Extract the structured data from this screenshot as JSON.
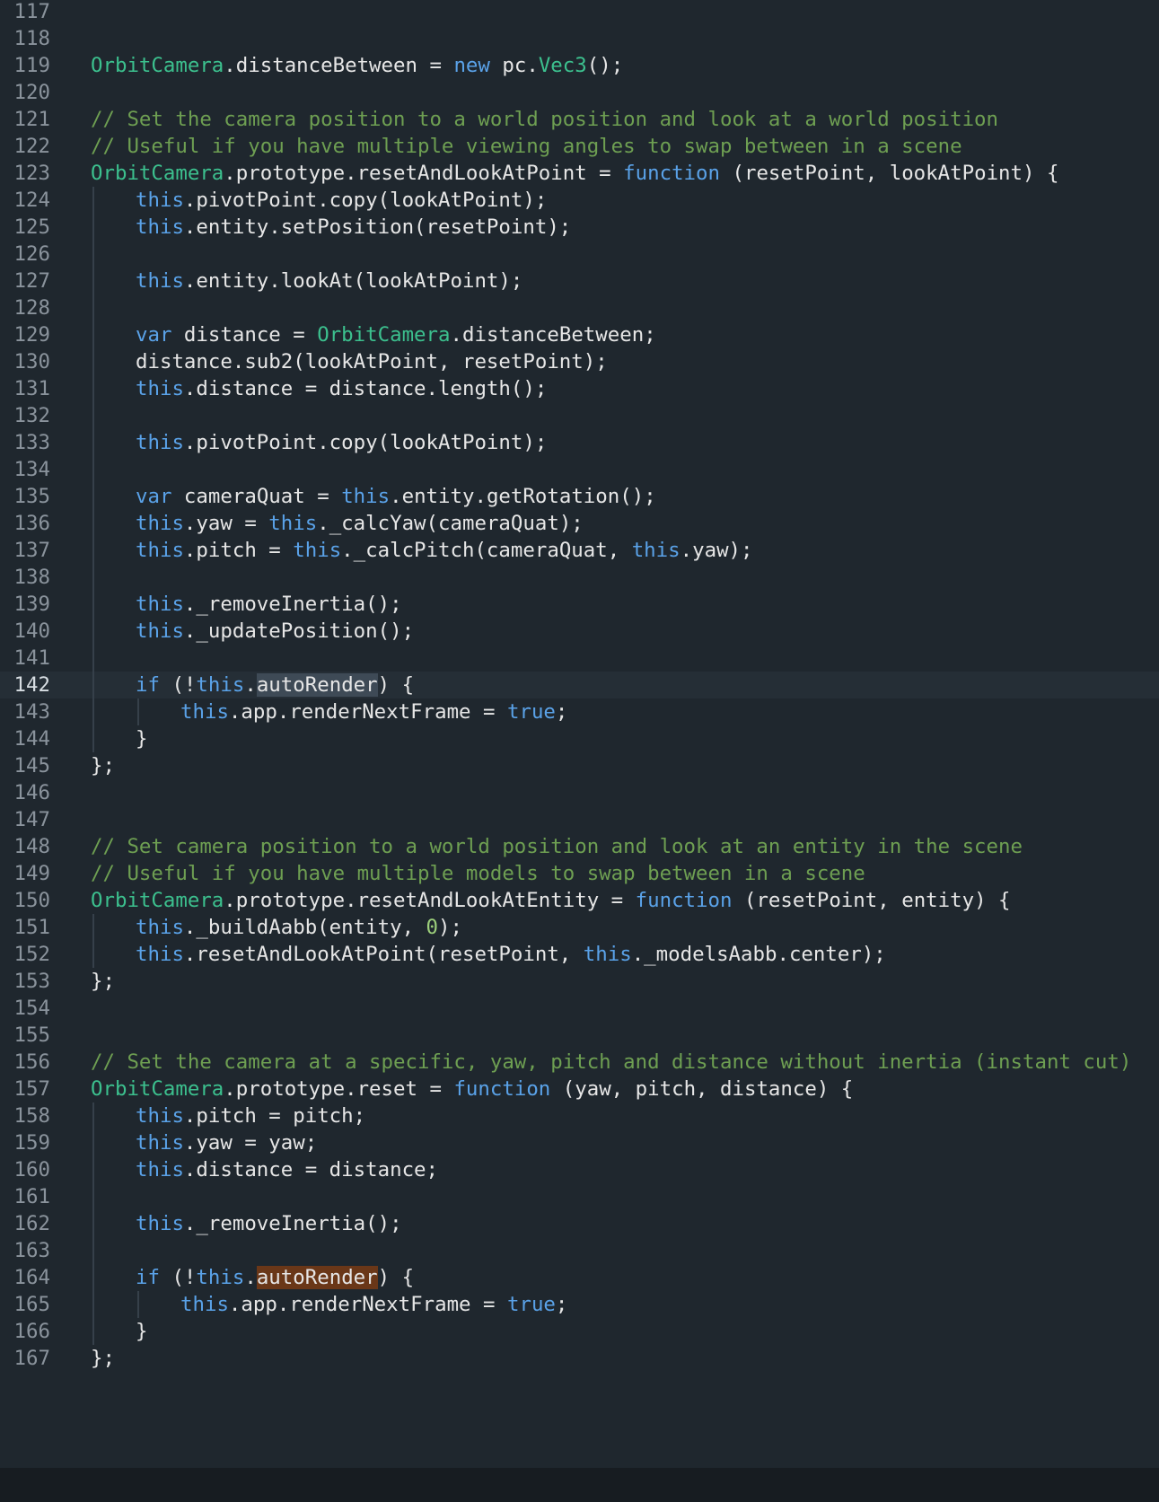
{
  "editor": {
    "language": "javascript",
    "current_line": 142,
    "colors": {
      "background": "#1f272e",
      "keyword": "#5aa2e8",
      "class": "#3cc08e",
      "comment": "#6e9f52",
      "number": "#9ccf7b",
      "selection_highlight": "#3e4a56",
      "find_highlight": "#6a3718"
    },
    "lines": [
      {
        "n": "117",
        "indent": 0,
        "tokens": []
      },
      {
        "n": "118",
        "indent": 0,
        "tokens": []
      },
      {
        "n": "119",
        "indent": 0,
        "tokens": [
          [
            "cls",
            "OrbitCamera"
          ],
          [
            "txt",
            ".distanceBetween = "
          ],
          [
            "kw",
            "new"
          ],
          [
            "txt",
            " pc."
          ],
          [
            "cls",
            "Vec3"
          ],
          [
            "txt",
            "();"
          ]
        ]
      },
      {
        "n": "120",
        "indent": 0,
        "tokens": []
      },
      {
        "n": "121",
        "indent": 0,
        "tokens": [
          [
            "cm",
            "// Set the camera position to a world position and look at a world position"
          ]
        ]
      },
      {
        "n": "122",
        "indent": 0,
        "tokens": [
          [
            "cm",
            "// Useful if you have multiple viewing angles to swap between in a scene"
          ]
        ]
      },
      {
        "n": "123",
        "indent": 0,
        "tokens": [
          [
            "cls",
            "OrbitCamera"
          ],
          [
            "txt",
            ".prototype.resetAndLookAtPoint = "
          ],
          [
            "kw",
            "function"
          ],
          [
            "txt",
            " (resetPoint, lookAtPoint) {"
          ]
        ]
      },
      {
        "n": "124",
        "indent": 1,
        "tokens": [
          [
            "kw",
            "this"
          ],
          [
            "txt",
            ".pivotPoint.copy(lookAtPoint);"
          ]
        ]
      },
      {
        "n": "125",
        "indent": 1,
        "tokens": [
          [
            "kw",
            "this"
          ],
          [
            "txt",
            ".entity.setPosition(resetPoint);"
          ]
        ]
      },
      {
        "n": "126",
        "indent": 1,
        "tokens": []
      },
      {
        "n": "127",
        "indent": 1,
        "tokens": [
          [
            "kw",
            "this"
          ],
          [
            "txt",
            ".entity.lookAt(lookAtPoint);"
          ]
        ]
      },
      {
        "n": "128",
        "indent": 1,
        "tokens": []
      },
      {
        "n": "129",
        "indent": 1,
        "tokens": [
          [
            "kw",
            "var"
          ],
          [
            "txt",
            " distance = "
          ],
          [
            "cls",
            "OrbitCamera"
          ],
          [
            "txt",
            ".distanceBetween;"
          ]
        ]
      },
      {
        "n": "130",
        "indent": 1,
        "tokens": [
          [
            "txt",
            "distance.sub2(lookAtPoint, resetPoint);"
          ]
        ]
      },
      {
        "n": "131",
        "indent": 1,
        "tokens": [
          [
            "kw",
            "this"
          ],
          [
            "txt",
            ".distance = distance.length();"
          ]
        ]
      },
      {
        "n": "132",
        "indent": 1,
        "tokens": []
      },
      {
        "n": "133",
        "indent": 1,
        "tokens": [
          [
            "kw",
            "this"
          ],
          [
            "txt",
            ".pivotPoint.copy(lookAtPoint);"
          ]
        ]
      },
      {
        "n": "134",
        "indent": 1,
        "tokens": []
      },
      {
        "n": "135",
        "indent": 1,
        "tokens": [
          [
            "kw",
            "var"
          ],
          [
            "txt",
            " cameraQuat = "
          ],
          [
            "kw",
            "this"
          ],
          [
            "txt",
            ".entity.getRotation();"
          ]
        ]
      },
      {
        "n": "136",
        "indent": 1,
        "tokens": [
          [
            "kw",
            "this"
          ],
          [
            "txt",
            ".yaw = "
          ],
          [
            "kw",
            "this"
          ],
          [
            "txt",
            "._calcYaw(cameraQuat);"
          ]
        ]
      },
      {
        "n": "137",
        "indent": 1,
        "tokens": [
          [
            "kw",
            "this"
          ],
          [
            "txt",
            ".pitch = "
          ],
          [
            "kw",
            "this"
          ],
          [
            "txt",
            "._calcPitch(cameraQuat, "
          ],
          [
            "kw",
            "this"
          ],
          [
            "txt",
            ".yaw);"
          ]
        ]
      },
      {
        "n": "138",
        "indent": 1,
        "tokens": []
      },
      {
        "n": "139",
        "indent": 1,
        "tokens": [
          [
            "kw",
            "this"
          ],
          [
            "txt",
            "._removeInertia();"
          ]
        ]
      },
      {
        "n": "140",
        "indent": 1,
        "tokens": [
          [
            "kw",
            "this"
          ],
          [
            "txt",
            "._updatePosition();"
          ]
        ]
      },
      {
        "n": "141",
        "indent": 1,
        "tokens": []
      },
      {
        "n": "142",
        "indent": 1,
        "tokens": [
          [
            "kw",
            "if"
          ],
          [
            "txt",
            " (!"
          ],
          [
            "kw",
            "this"
          ],
          [
            "txt",
            "."
          ],
          [
            "hl",
            "autoRender"
          ],
          [
            "txt",
            ") {"
          ]
        ]
      },
      {
        "n": "143",
        "indent": 2,
        "tokens": [
          [
            "kw",
            "this"
          ],
          [
            "txt",
            ".app.renderNextFrame = "
          ],
          [
            "kw",
            "true"
          ],
          [
            "txt",
            ";"
          ]
        ]
      },
      {
        "n": "144",
        "indent": 1,
        "tokens": [
          [
            "txt",
            "}"
          ]
        ]
      },
      {
        "n": "145",
        "indent": 0,
        "tokens": [
          [
            "txt",
            "};"
          ]
        ]
      },
      {
        "n": "146",
        "indent": 0,
        "tokens": []
      },
      {
        "n": "147",
        "indent": 0,
        "tokens": []
      },
      {
        "n": "148",
        "indent": 0,
        "tokens": [
          [
            "cm",
            "// Set camera position to a world position and look at an entity in the scene"
          ]
        ]
      },
      {
        "n": "149",
        "indent": 0,
        "tokens": [
          [
            "cm",
            "// Useful if you have multiple models to swap between in a scene"
          ]
        ]
      },
      {
        "n": "150",
        "indent": 0,
        "tokens": [
          [
            "cls",
            "OrbitCamera"
          ],
          [
            "txt",
            ".prototype.resetAndLookAtEntity = "
          ],
          [
            "kw",
            "function"
          ],
          [
            "txt",
            " (resetPoint, entity) {"
          ]
        ]
      },
      {
        "n": "151",
        "indent": 1,
        "tokens": [
          [
            "kw",
            "this"
          ],
          [
            "txt",
            "._buildAabb(entity, "
          ],
          [
            "num",
            "0"
          ],
          [
            "txt",
            ");"
          ]
        ]
      },
      {
        "n": "152",
        "indent": 1,
        "tokens": [
          [
            "kw",
            "this"
          ],
          [
            "txt",
            ".resetAndLookAtPoint(resetPoint, "
          ],
          [
            "kw",
            "this"
          ],
          [
            "txt",
            "._modelsAabb.center);"
          ]
        ]
      },
      {
        "n": "153",
        "indent": 0,
        "tokens": [
          [
            "txt",
            "};"
          ]
        ]
      },
      {
        "n": "154",
        "indent": 0,
        "tokens": []
      },
      {
        "n": "155",
        "indent": 0,
        "tokens": []
      },
      {
        "n": "156",
        "indent": 0,
        "tokens": [
          [
            "cm",
            "// Set the camera at a specific, yaw, pitch and distance without inertia (instant cut)"
          ]
        ]
      },
      {
        "n": "157",
        "indent": 0,
        "tokens": [
          [
            "cls",
            "OrbitCamera"
          ],
          [
            "txt",
            ".prototype.reset = "
          ],
          [
            "kw",
            "function"
          ],
          [
            "txt",
            " (yaw, pitch, distance) {"
          ]
        ]
      },
      {
        "n": "158",
        "indent": 1,
        "tokens": [
          [
            "kw",
            "this"
          ],
          [
            "txt",
            ".pitch = pitch;"
          ]
        ]
      },
      {
        "n": "159",
        "indent": 1,
        "tokens": [
          [
            "kw",
            "this"
          ],
          [
            "txt",
            ".yaw = yaw;"
          ]
        ]
      },
      {
        "n": "160",
        "indent": 1,
        "tokens": [
          [
            "kw",
            "this"
          ],
          [
            "txt",
            ".distance = distance;"
          ]
        ]
      },
      {
        "n": "161",
        "indent": 1,
        "tokens": []
      },
      {
        "n": "162",
        "indent": 1,
        "tokens": [
          [
            "kw",
            "this"
          ],
          [
            "txt",
            "._removeInertia();"
          ]
        ]
      },
      {
        "n": "163",
        "indent": 1,
        "tokens": []
      },
      {
        "n": "164",
        "indent": 1,
        "tokens": [
          [
            "kw",
            "if"
          ],
          [
            "txt",
            " (!"
          ],
          [
            "kw",
            "this"
          ],
          [
            "txt",
            "."
          ],
          [
            "hl2",
            "autoRender"
          ],
          [
            "txt",
            ") {"
          ]
        ]
      },
      {
        "n": "165",
        "indent": 2,
        "tokens": [
          [
            "kw",
            "this"
          ],
          [
            "txt",
            ".app.renderNextFrame = "
          ],
          [
            "kw",
            "true"
          ],
          [
            "txt",
            ";"
          ]
        ]
      },
      {
        "n": "166",
        "indent": 1,
        "tokens": [
          [
            "txt",
            "}"
          ]
        ]
      },
      {
        "n": "167",
        "indent": 0,
        "tokens": [
          [
            "txt",
            "};"
          ]
        ]
      }
    ]
  }
}
